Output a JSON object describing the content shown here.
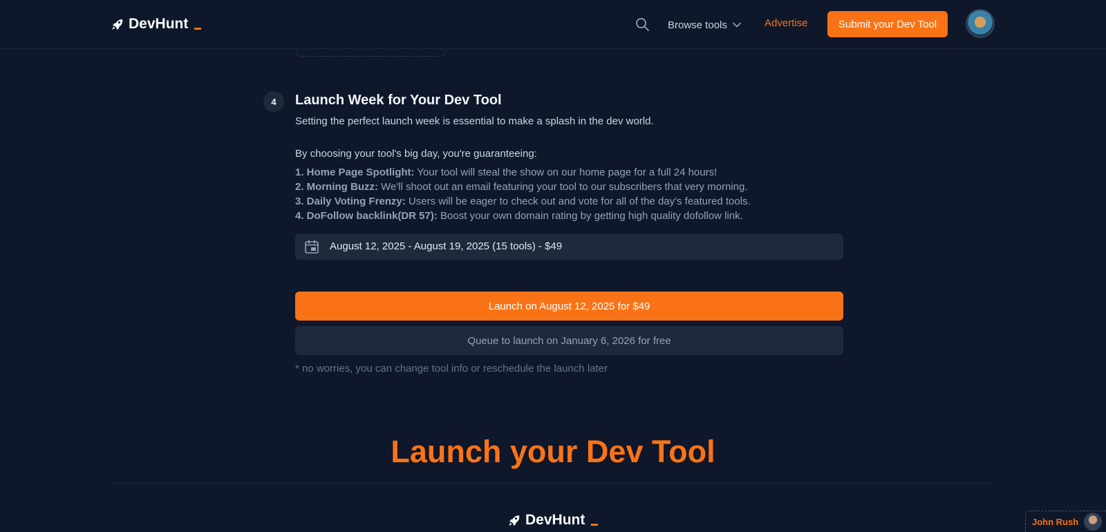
{
  "header": {
    "logo_text": "DevHunt",
    "browse_label": "Browse tools",
    "advertise_label": "Advertise",
    "submit_label": "Submit your Dev Tool"
  },
  "step": {
    "number": "4",
    "title": "Launch Week for Your Dev Tool",
    "subtitle": "Setting the perfect launch week is essential to make a splash in the dev world.",
    "benefits_intro": "By choosing your tool's big day, you're guaranteeing:",
    "benefits": [
      {
        "label": "1. Home Page Spotlight:",
        "text": " Your tool will steal the show on our home page for a full 24 hours!"
      },
      {
        "label": "2. Morning Buzz:",
        "text": " We'll shoot out an email featuring your tool to our subscribers that very morning."
      },
      {
        "label": "3. Daily Voting Frenzy:",
        "text": " Users will be eager to check out and vote for all of the day's featured tools."
      },
      {
        "label": "4. DoFollow backlink(DR 57):",
        "text": " Boost your own domain rating by getting high quality dofollow link."
      }
    ],
    "selected_week": "August 12, 2025 - August 19, 2025 (15 tools) - $49",
    "launch_button": "Launch on August 12, 2025 for $49",
    "queue_button": "Queue to launch on January 6, 2026 for free",
    "note": "* no worries, you can change tool info or reschedule the launch later"
  },
  "cta": {
    "heading": "Launch your Dev Tool"
  },
  "footer": {
    "logo_text": "DevHunt"
  },
  "maker": {
    "name": "John Rush"
  },
  "colors": {
    "background": "#0f172a",
    "accent": "#f97316",
    "surface": "#1e293b"
  }
}
